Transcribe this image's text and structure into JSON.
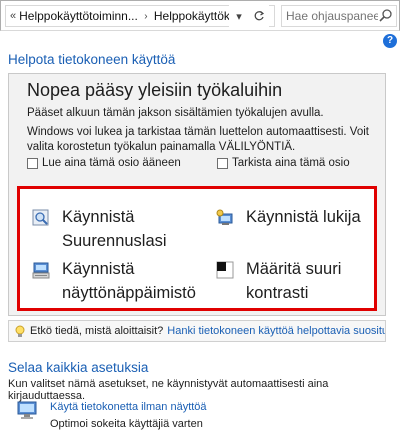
{
  "address": {
    "breadcrumbs": [
      "Helppokäyttötoiminn...",
      "Helppokäyttökeskus"
    ],
    "search_placeholder": "Hae ohjauspaneelista"
  },
  "page": {
    "title": "Helpota tietokoneen käyttöä"
  },
  "quick_access": {
    "title": "Nopea pääsy yleisiin työkaluihin",
    "desc1": "Pääset alkuun tämän jakson sisältämien työkalujen avulla.",
    "desc2": "Windows voi lukea ja tarkistaa tämän luettelon automaattisesti. Voit valita korostetun työkalun painamalla VÄLILYÖNTIÄ.",
    "checkbox_read": "Lue aina tämä osio ääneen",
    "checkbox_scan": "Tarkista aina tämä osio",
    "tools": {
      "magnifier": "Käynnistä\nSuurennuslasi",
      "narrator": "Käynnistä lukija",
      "keyboard": "Käynnistä\nnäyttönäppäimistö",
      "contrast": "Määritä suuri\nkontrasti"
    }
  },
  "tip": {
    "text": "Etkö tiedä, mistä aloittaisit?",
    "link": "Hanki tietokoneen käyttöä helpottavia suosituksia"
  },
  "browse": {
    "title": "Selaa kaikkia asetuksia",
    "desc": "Kun valitset nämä asetukset, ne käynnistyvät automaattisesti aina kirjauduttaessa.",
    "item_link": "Käytä tietokonetta ilman näyttöä",
    "item_desc": "Optimoi sokeita käyttäjiä varten"
  },
  "colors": {
    "link": "#1a5fb4",
    "highlight_border": "#e00000"
  }
}
